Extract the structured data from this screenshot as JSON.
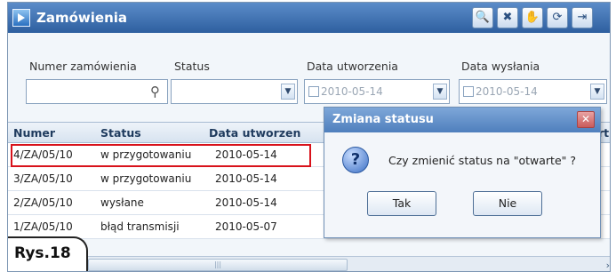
{
  "window": {
    "title": "Zamówienia",
    "toolbar": [
      {
        "icon": "search-icon",
        "glyph": "🔍"
      },
      {
        "icon": "tools-icon",
        "glyph": "✖"
      },
      {
        "icon": "hand-icon",
        "glyph": "✋"
      },
      {
        "icon": "refresh-icon",
        "glyph": "⟳"
      },
      {
        "icon": "export-icon",
        "glyph": "⇥"
      }
    ]
  },
  "filters": {
    "order_number_label": "Numer zamówienia",
    "order_number_value": "",
    "status_label": "Status",
    "status_value": "",
    "created_label": "Data utworzenia",
    "created_value": "2010-05-14",
    "sent_label": "Data wysłania",
    "sent_value": "2010-05-14"
  },
  "table": {
    "columns": [
      "Numer",
      "Status",
      "Data utworzen",
      "rt"
    ],
    "rows": [
      {
        "numer": "4/ZA/05/10",
        "status": "w przygotowaniu",
        "data": "2010-05-14"
      },
      {
        "numer": "3/ZA/05/10",
        "status": "w przygotowaniu",
        "data": "2010-05-14"
      },
      {
        "numer": "2/ZA/05/10",
        "status": "wysłane",
        "data": "2010-05-14"
      },
      {
        "numer": "1/ZA/05/10",
        "status": "błąd transmisji",
        "data": "2010-05-07"
      }
    ],
    "highlighted_row": 0
  },
  "figure_label": "Rys.18",
  "dialog": {
    "title": "Zmiana statusu",
    "message": "Czy zmienić status na \"otwarte\" ?",
    "yes_label": "Tak",
    "no_label": "Nie"
  },
  "colors": {
    "titlebar": "#2e5f9f",
    "highlight": "#d8121b"
  }
}
